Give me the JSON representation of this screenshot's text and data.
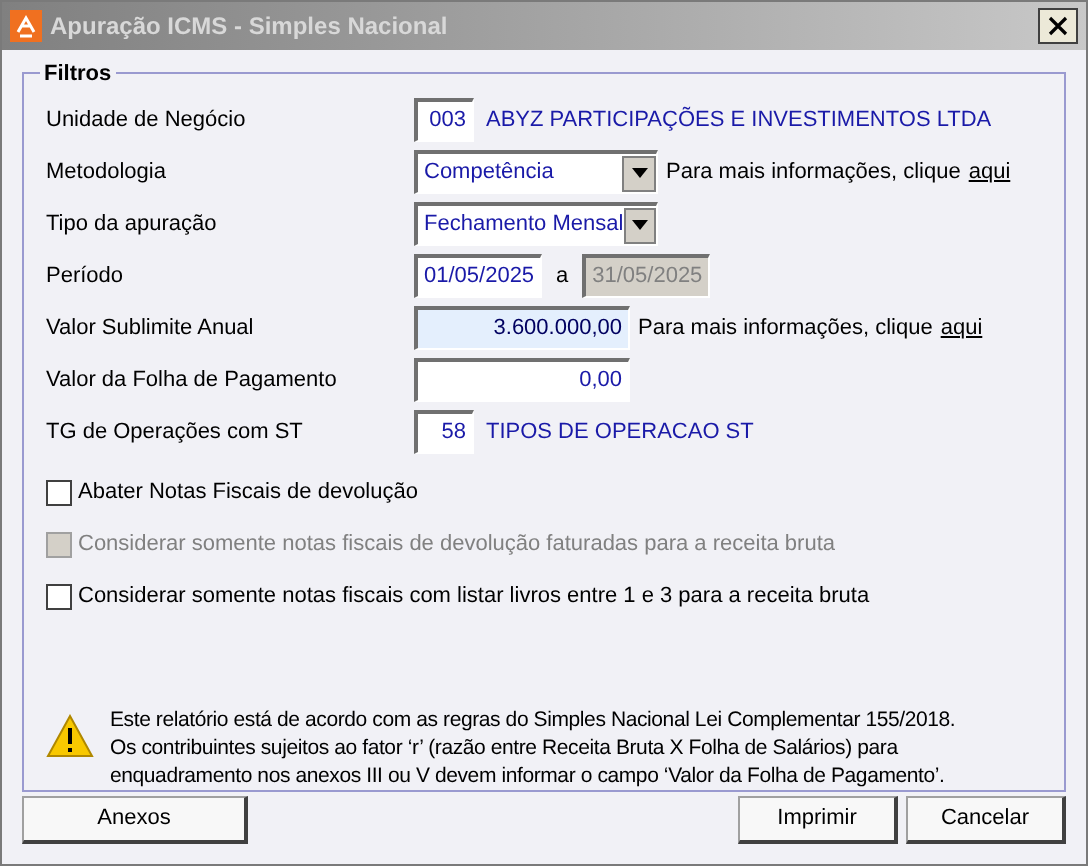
{
  "window": {
    "title": "Apuração ICMS - Simples Nacional"
  },
  "filters": {
    "title": "Filtros",
    "fields": [
      {
        "kind": "code",
        "label": "Unidade de Negócio",
        "value": "003",
        "description": "ABYZ PARTICIPAÇÕES E INVESTIMENTOS LTDA"
      },
      {
        "kind": "dropdown",
        "label": "Metodologia",
        "value": "Competência",
        "info": "Para mais informações, clique",
        "link": "aqui"
      },
      {
        "kind": "dropdown",
        "label": "Tipo da apuração",
        "value": "Fechamento Mensal"
      },
      {
        "kind": "period",
        "label": "Período",
        "value": "01/05/2025",
        "separator": "a",
        "end_value": "31/05/2025",
        "end_disabled": true
      },
      {
        "kind": "amount",
        "label": "Valor Sublimite Anual",
        "value": "3.600.000,00",
        "highlighted": true,
        "info": "Para mais informações, clique",
        "link": "aqui"
      },
      {
        "kind": "amount",
        "label": "Valor da Folha de Pagamento",
        "value": "0,00",
        "highlighted": false
      },
      {
        "kind": "code",
        "label": "TG de Operações com ST",
        "value": "58",
        "description": "TIPOS DE OPERACAO ST"
      }
    ],
    "checkboxes": [
      {
        "label": "Abater Notas Fiscais de devolução",
        "checked": false,
        "disabled": false
      },
      {
        "label": "Considerar somente notas fiscais de devolução faturadas para a receita bruta",
        "checked": false,
        "disabled": true
      },
      {
        "label": "Considerar somente notas fiscais com listar livros entre 1 e 3 para a receita bruta",
        "checked": false,
        "disabled": false
      }
    ],
    "notice": [
      "Este relatório está de acordo com as regras do Simples Nacional Lei Complementar 155/2018.",
      "Os contribuintes sujeitos ao fator ‘r’ (razão entre Receita Bruta X Folha de Salários) para",
      "enquadramento nos anexos III ou V devem informar o campo ‘Valor da Folha de Pagamento’."
    ]
  },
  "buttons": [
    {
      "label": "Anexos"
    },
    {
      "label": "Imprimir"
    },
    {
      "label": "Cancelar"
    }
  ]
}
